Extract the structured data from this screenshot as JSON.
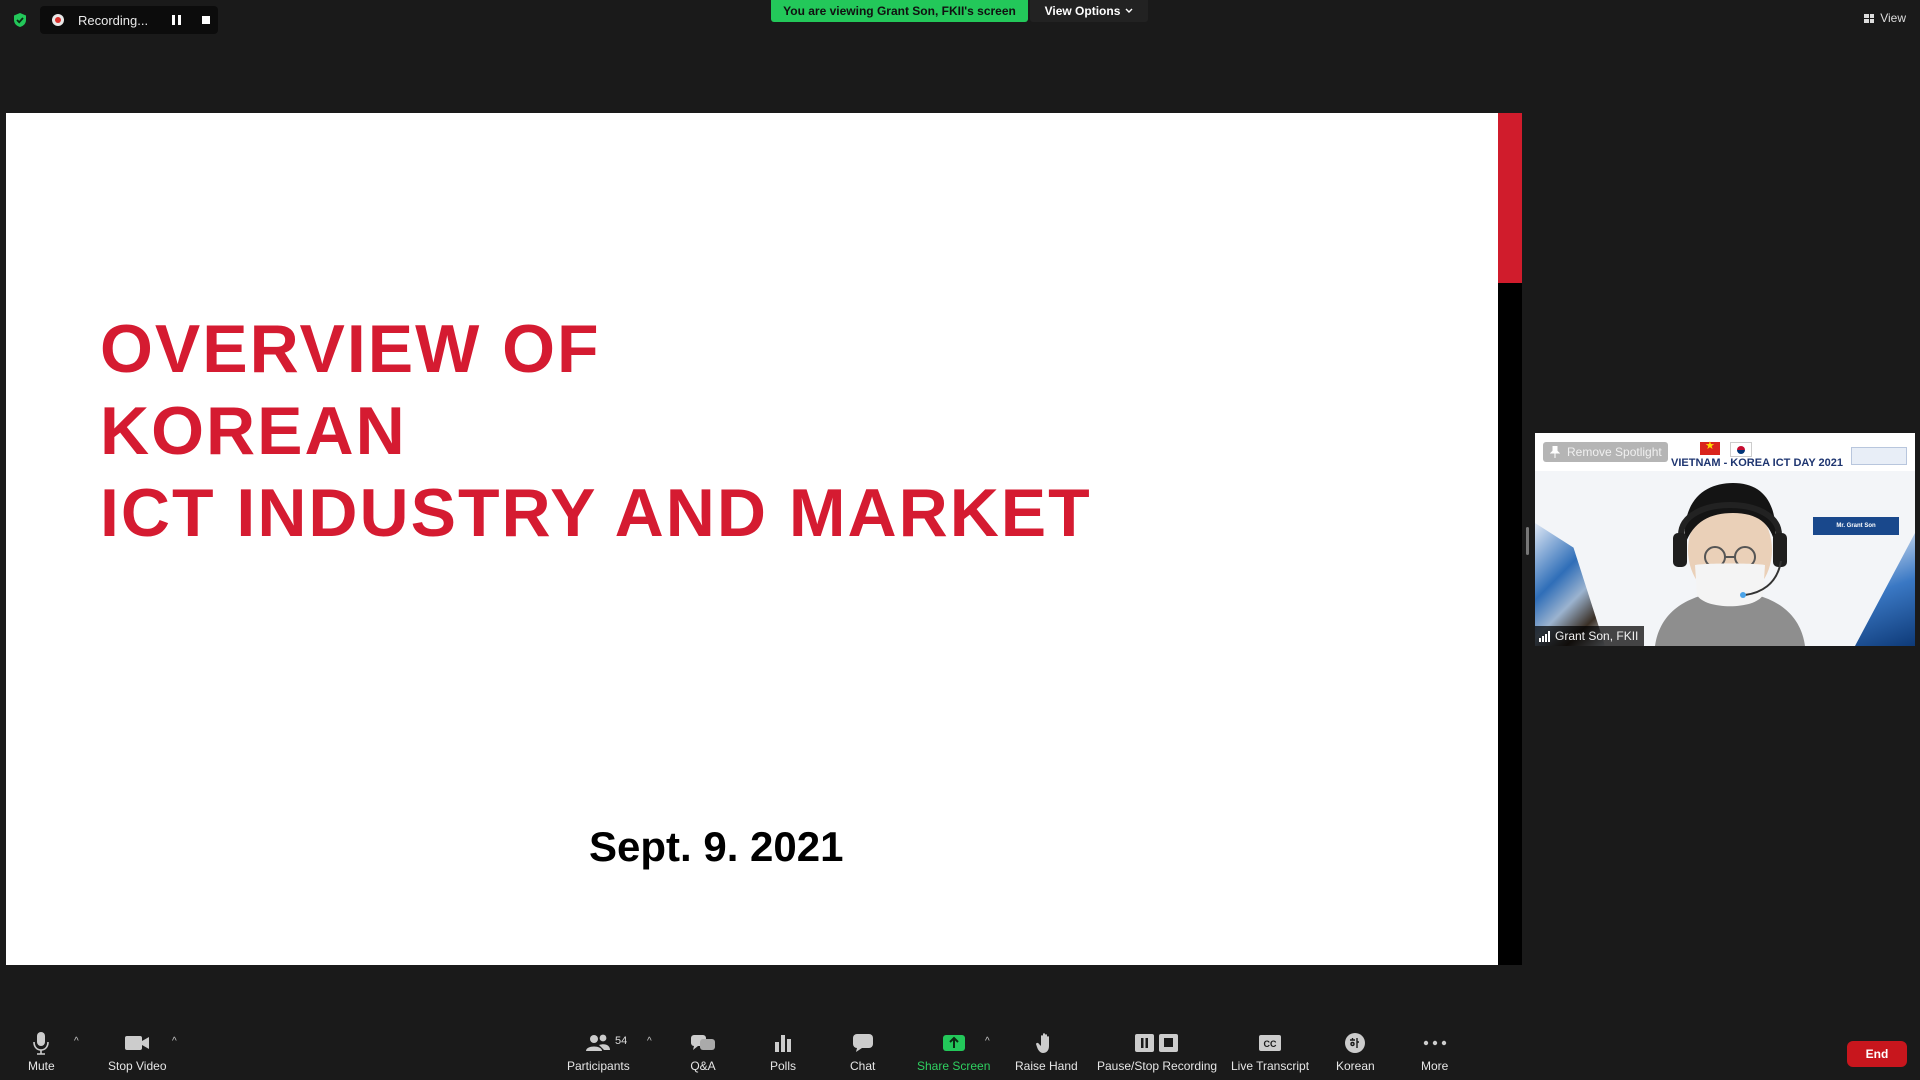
{
  "top_bar": {
    "recording_label": "Recording...",
    "viewing_banner": "You are viewing Grant Son, FKII's screen",
    "view_options_label": "View Options",
    "view_label": "View"
  },
  "slide": {
    "title_lines": [
      "OVERVIEW OF",
      "KOREAN",
      "ICT INDUSTRY AND MARKET"
    ],
    "date": "Sept. 9. 2021"
  },
  "video_thumb": {
    "remove_spotlight_label": "Remove Spotlight",
    "event_title": "VIETNAM - KOREA ICT DAY 2021",
    "speaker_tag": "Mr. Grant Son",
    "participant_name": "Grant Son, FKII"
  },
  "toolbar": {
    "mute": "Mute",
    "stop_video": "Stop Video",
    "participants": "Participants",
    "participants_count": "54",
    "qa": "Q&A",
    "polls": "Polls",
    "chat": "Chat",
    "share_screen": "Share Screen",
    "raise_hand": "Raise Hand",
    "pause_stop_recording": "Pause/Stop Recording",
    "live_transcript": "Live Transcript",
    "korean": "Korean",
    "more": "More",
    "end": "End"
  },
  "colors": {
    "background": "#1a1a1a",
    "accent_green": "#23c85a",
    "slide_red": "#d51b31",
    "end_red": "#c8161d"
  }
}
